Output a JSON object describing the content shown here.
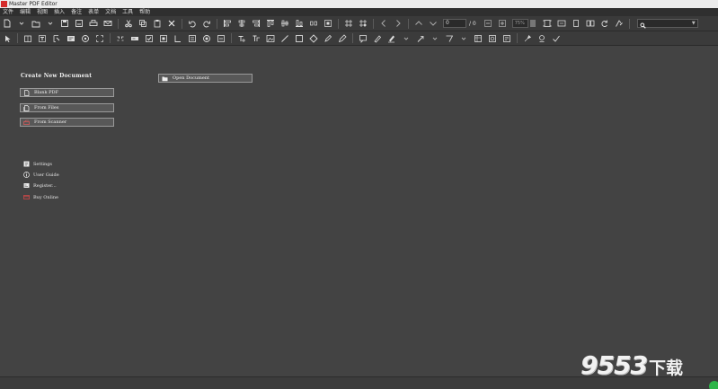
{
  "window": {
    "title": "Master PDF Editor"
  },
  "menu": [
    "文件",
    "编辑",
    "视图",
    "插入",
    "备注",
    "表单",
    "文档",
    "工具",
    "帮助"
  ],
  "toolbar": {
    "page_value": "0",
    "page_total": "/ 0",
    "zoom_value": "75%",
    "search_value": "",
    "icons_row1": [
      "new-document-icon",
      "dropdown-icon",
      "open-icon",
      "dropdown-icon",
      "save-icon",
      "save-as-icon",
      "print-icon",
      "email-icon",
      "cut-icon",
      "copy-icon",
      "paste-icon",
      "delete-icon",
      "undo-icon",
      "redo-icon",
      "align-left-icon",
      "align-center-icon",
      "align-right-icon",
      "align-top-icon",
      "align-middle-icon",
      "align-bottom-icon",
      "distribute-icon",
      "resize-icon",
      "grid-icon",
      "snap-icon",
      "previous-view-icon",
      "next-view-icon",
      "previous-page-icon",
      "next-page-icon",
      "zoom-out-icon",
      "zoom-in-icon",
      "fit-page-icon",
      "fit-width-icon",
      "single-page-icon",
      "two-page-icon",
      "rotate-icon",
      "find-icon"
    ],
    "icons_row2": [
      "select-icon",
      "hand-icon",
      "edit-text-icon",
      "edit-object-icon",
      "form-icon",
      "snapshot-icon",
      "link-icon",
      "sign-icon",
      "text-field-icon",
      "checkbox-icon",
      "radio-icon",
      "combo-box-icon",
      "list-box-icon",
      "button-icon",
      "image-field-icon",
      "add-text-icon",
      "add-image-icon",
      "line-icon",
      "rectangle-icon",
      "ellipse-icon",
      "polygon-icon",
      "pencil-icon",
      "note-icon",
      "highlight-icon",
      "underline-icon",
      "strikeout-icon",
      "arrow-icon",
      "polyline-icon",
      "stamp-icon",
      "attachment-icon",
      "measure-icon",
      "search-text-icon",
      "check-icon"
    ]
  },
  "start": {
    "heading": "Create New Document",
    "blank_pdf": "Blank PDF",
    "from_files": "From Files",
    "from_scanner": "From Scanner",
    "open_document": "Open Document",
    "settings": "Settings",
    "user_guide": "User Guide",
    "register": "Register...",
    "buy_online": "Buy Online"
  },
  "watermark": {
    "number": "9553",
    "suffix": "下载"
  },
  "colors": {
    "background": "#434343",
    "accent": "#d42b2b",
    "button": "#585858"
  }
}
